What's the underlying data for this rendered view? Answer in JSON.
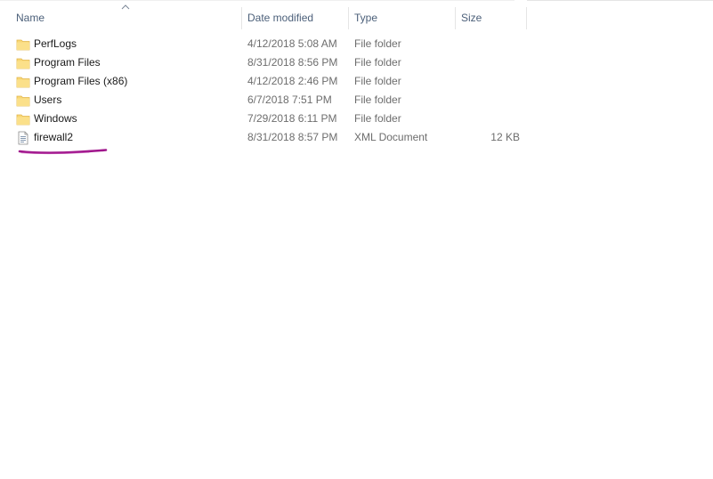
{
  "columns": {
    "name": "Name",
    "date_modified": "Date modified",
    "type": "Type",
    "size": "Size"
  },
  "files": [
    {
      "name": "PerfLogs",
      "date": "4/12/2018 5:08 AM",
      "type": "File folder",
      "size": "",
      "icon": "folder-icon"
    },
    {
      "name": "Program Files",
      "date": "8/31/2018 8:56 PM",
      "type": "File folder",
      "size": "",
      "icon": "folder-icon"
    },
    {
      "name": "Program Files (x86)",
      "date": "4/12/2018 2:46 PM",
      "type": "File folder",
      "size": "",
      "icon": "folder-icon"
    },
    {
      "name": "Users",
      "date": "6/7/2018 7:51 PM",
      "type": "File folder",
      "size": "",
      "icon": "folder-icon"
    },
    {
      "name": "Windows",
      "date": "7/29/2018 6:11 PM",
      "type": "File folder",
      "size": "",
      "icon": "folder-icon"
    },
    {
      "name": "firewall2",
      "date": "8/31/2018 8:57 PM",
      "type": "XML Document",
      "size": "12 KB",
      "icon": "xml-document-icon"
    }
  ],
  "sort": {
    "column": "name",
    "direction": "ascending",
    "icon": "sort-ascending-icon"
  },
  "colors": {
    "folder": "#f8d775",
    "folder_dark": "#e7b84a",
    "header_text": "#4c607a",
    "annotation": "#a0168c"
  }
}
